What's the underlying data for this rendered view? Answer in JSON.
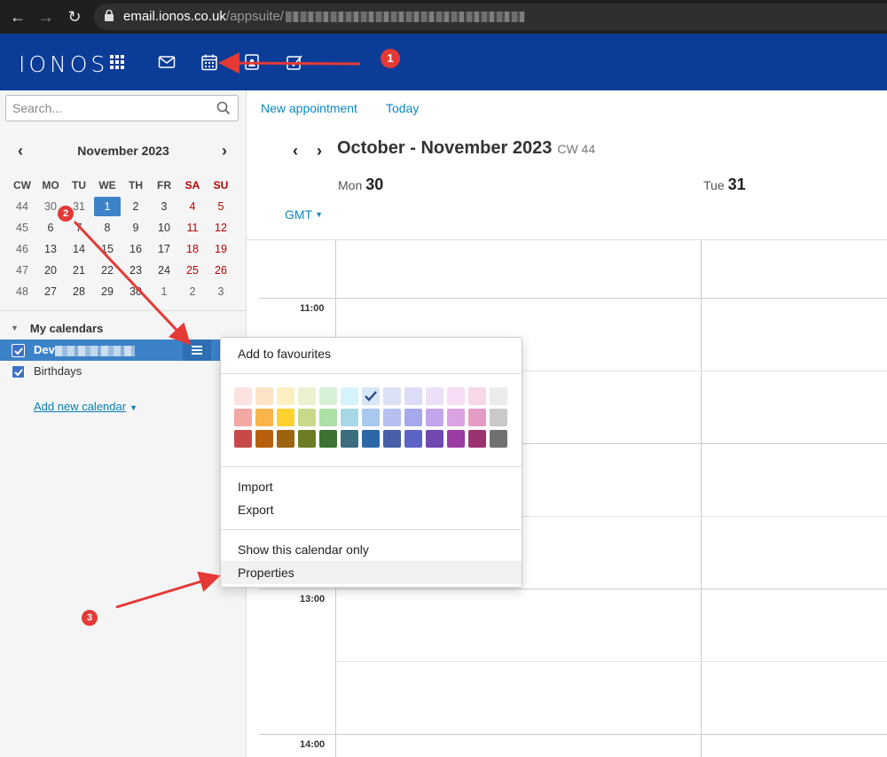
{
  "browser": {
    "url_host": "email.ionos.co.uk",
    "url_path": "/appsuite/"
  },
  "header": {
    "logo": "IONOS",
    "icons": [
      "apps-grid-icon",
      "mail-icon",
      "calendar-icon",
      "address-book-icon",
      "tasks-icon"
    ]
  },
  "sidebar": {
    "search_placeholder": "Search...",
    "mini_calendar": {
      "month": "November 2023",
      "headers": [
        "CW",
        "MO",
        "TU",
        "WE",
        "TH",
        "FR",
        "SA",
        "SU"
      ],
      "rows": [
        [
          "44",
          "30",
          "31",
          "1",
          "2",
          "3",
          "4",
          "5"
        ],
        [
          "45",
          "6",
          "7",
          "8",
          "9",
          "10",
          "11",
          "12"
        ],
        [
          "46",
          "13",
          "14",
          "15",
          "16",
          "17",
          "18",
          "19"
        ],
        [
          "47",
          "20",
          "21",
          "22",
          "23",
          "24",
          "25",
          "26"
        ],
        [
          "48",
          "27",
          "28",
          "29",
          "30",
          "1",
          "2",
          "3"
        ]
      ],
      "today": "1"
    },
    "my_calendars_label": "My calendars",
    "calendars": [
      {
        "name": "Dev",
        "checked": true,
        "active": true
      },
      {
        "name": "Birthdays",
        "checked": true,
        "active": false
      }
    ],
    "add_calendar_label": "Add new calendar"
  },
  "toolbar": {
    "new_appointment": "New appointment",
    "today": "Today"
  },
  "calendar_view": {
    "title": "October - November 2023",
    "cw": "CW 44",
    "days": [
      {
        "dow": "Mon",
        "date": "30"
      },
      {
        "dow": "Tue",
        "date": "31"
      }
    ],
    "timezone": "GMT",
    "times": [
      "11:00",
      "13:00",
      "14:00"
    ]
  },
  "context_menu": {
    "add_favourites": "Add to favourites",
    "import": "Import",
    "export": "Export",
    "show_only": "Show this calendar only",
    "properties": "Properties",
    "colors": [
      [
        "#fde2e2",
        "#fde3c5",
        "#fdf0c0",
        "#ebf1cf",
        "#d8f1d6",
        "#d5f3fa",
        "#d7e6f8",
        "#dbe2f7",
        "#dcdcf6",
        "#ece0f7",
        "#f7dcf5",
        "#f6d8e8",
        "#ebebeb"
      ],
      [
        "#f2a8a5",
        "#f9b44a",
        "#fdd22f",
        "#c9d98a",
        "#ade0a6",
        "#a7d8e6",
        "#a8c8ee",
        "#b5bff0",
        "#a7a8ec",
        "#c1a6ec",
        "#dba2e4",
        "#e59bc3",
        "#c9c9c9"
      ],
      [
        "#c84a48",
        "#b85f0d",
        "#9c6410",
        "#6c7d24",
        "#3c7332",
        "#3b6d7d",
        "#2c67a8",
        "#465fa8",
        "#5d63c2",
        "#7048b0",
        "#9b3ba4",
        "#9d3271",
        "#707070"
      ]
    ],
    "selected_color": "#d7e6f8"
  },
  "annotations": [
    "1",
    "2",
    "3"
  ]
}
